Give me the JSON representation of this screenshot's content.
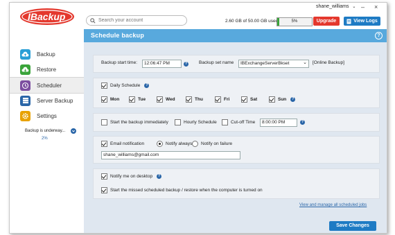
{
  "app": {
    "brand": "IBackup"
  },
  "header": {
    "search_placeholder": "Search your account",
    "username": "shane_williams",
    "usage_text": "2.60 GB of 50.00 GB used",
    "quota_percent": 5,
    "quota_label": "5%",
    "upgrade_label": "Upgrade",
    "view_logs_label": "View Logs"
  },
  "sidebar": {
    "items": [
      {
        "label": "Backup",
        "icon": "cloud-upload-icon",
        "color": "#2a9fd6"
      },
      {
        "label": "Restore",
        "icon": "cloud-download-icon",
        "color": "#3aa43a"
      },
      {
        "label": "Scheduler",
        "icon": "clock-icon",
        "color": "#7c4ea0",
        "active": true
      },
      {
        "label": "Server Backup",
        "icon": "server-icon",
        "color": "#2a66a8"
      },
      {
        "label": "Settings",
        "icon": "gear-icon",
        "color": "#e8a200"
      }
    ],
    "status_text": "Backup is underway...",
    "status_percent": "2%"
  },
  "page": {
    "title": "Schedule  backup"
  },
  "form": {
    "start_time_label": "Backup start time:",
    "start_time_value": "12:06:47 PM",
    "backup_set_label": "Backup set name",
    "backup_set_value": "IBExchangeServerBkset",
    "backup_set_type": "[Online Backup]",
    "daily_schedule_label": "Daily Schedule",
    "days": [
      {
        "label": "Mon",
        "checked": true
      },
      {
        "label": "Tue",
        "checked": true
      },
      {
        "label": "Wed",
        "checked": true
      },
      {
        "label": "Thu",
        "checked": true
      },
      {
        "label": "Fri",
        "checked": true
      },
      {
        "label": "Sat",
        "checked": true
      },
      {
        "label": "Sun",
        "checked": true
      }
    ],
    "start_immediately_label": "Start the backup immediately",
    "hourly_schedule_label": "Hourly Schedule",
    "cutoff_label": "Cut-off Time",
    "cutoff_value": "8:00:00 PM",
    "email_notification_label": "Email notification",
    "notify_always_label": "Notify always",
    "notify_failure_label": "Notify on failure",
    "email_value": "shane_williams@gmail.com",
    "notify_desktop_label": "Notify me on desktop",
    "missed_label": "Start the missed scheduled backup / restore when the computer is turned on",
    "view_all_link": "View and manage all scheduled jobs",
    "save_label": "Save Changes"
  }
}
